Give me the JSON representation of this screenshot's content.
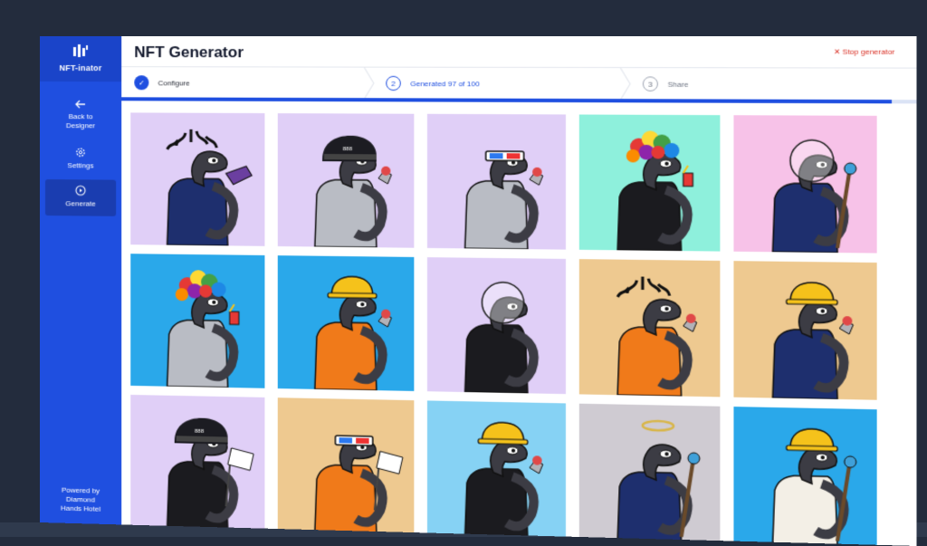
{
  "app": {
    "name": "NFT-inator"
  },
  "sidebar": {
    "items": [
      {
        "label_line1": "Back to",
        "label_line2": "Designer",
        "icon": "arrow-left-icon"
      },
      {
        "label_line1": "Settings",
        "label_line2": "",
        "icon": "gear-icon"
      },
      {
        "label_line1": "Generate",
        "label_line2": "",
        "icon": "play-circle-icon"
      }
    ],
    "footer": {
      "line1": "Powered by",
      "line2": "Diamond",
      "line3": "Hands Hotel"
    }
  },
  "header": {
    "title": "NFT Generator",
    "stop_label": "Stop generator",
    "stop_icon": "close-icon"
  },
  "stepper": {
    "steps": [
      {
        "number": "✓",
        "label": "Configure",
        "state": "done"
      },
      {
        "number": "2",
        "label": "Generated 97 of 100",
        "state": "active"
      },
      {
        "number": "3",
        "label": "Share",
        "state": "pending"
      }
    ],
    "progress": 0.97
  },
  "colors": {
    "brand": "#1f4fe0",
    "stop": "#d93025",
    "lavender": "#e0cff7",
    "mint": "#8ef0dc",
    "pink": "#f7c2e8",
    "sky": "#2aa8ea",
    "tan": "#eec990",
    "lightsky": "#86d2f4",
    "grey": "#cfcbd2"
  },
  "tiles": [
    {
      "bg": "#e0cff7",
      "hat": "dreads",
      "outfit": "police",
      "held": "blaster"
    },
    {
      "bg": "#e0cff7",
      "hat": "helmet",
      "outfit": "astro",
      "held": "torch"
    },
    {
      "bg": "#e0cff7",
      "hat": "glasses3d",
      "outfit": "astro",
      "held": "torch"
    },
    {
      "bg": "#8ef0dc",
      "hat": "rainbow",
      "outfit": "black",
      "held": "cup"
    },
    {
      "bg": "#f7c2e8",
      "hat": "bubble",
      "outfit": "police",
      "held": "staff"
    },
    {
      "bg": "#2aa8ea",
      "hat": "rainbow",
      "outfit": "astro",
      "held": "cup"
    },
    {
      "bg": "#2aa8ea",
      "hat": "hardhat",
      "outfit": "orange",
      "held": "torch"
    },
    {
      "bg": "#e0cff7",
      "hat": "bubble",
      "outfit": "black",
      "held": "none"
    },
    {
      "bg": "#eec990",
      "hat": "dreads",
      "outfit": "orange",
      "held": "torch"
    },
    {
      "bg": "#eec990",
      "hat": "hardhat",
      "outfit": "police",
      "held": "torch"
    },
    {
      "bg": "#e0cff7",
      "hat": "helmet",
      "outfit": "black",
      "held": "flag"
    },
    {
      "bg": "#eec990",
      "hat": "glasses3d",
      "outfit": "orange",
      "held": "flag"
    },
    {
      "bg": "#86d2f4",
      "hat": "hardhat",
      "outfit": "black",
      "held": "torch"
    },
    {
      "bg": "#cfcbd2",
      "hat": "halo",
      "outfit": "police",
      "held": "staff"
    },
    {
      "bg": "#2aa8ea",
      "hat": "hardhat",
      "outfit": "robe",
      "held": "staff"
    }
  ]
}
